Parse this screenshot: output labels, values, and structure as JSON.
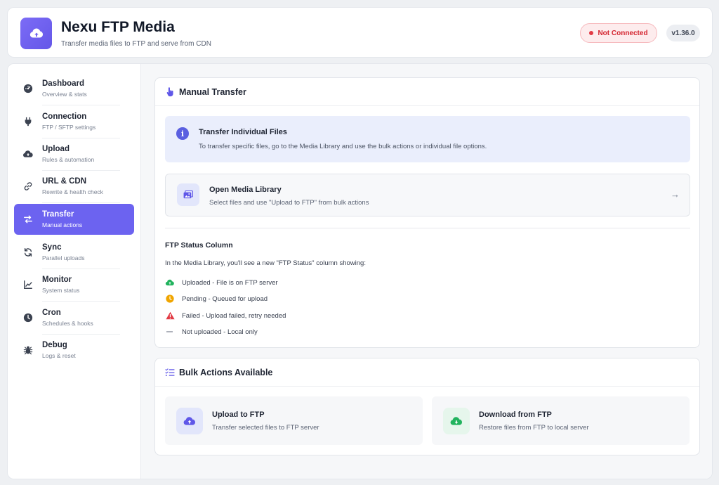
{
  "header": {
    "title": "Nexu FTP Media",
    "subtitle": "Transfer media files to FTP and serve from CDN",
    "status": "Not Connected",
    "version": "v1.36.0",
    "logo_icon": "cloud-upload-icon"
  },
  "sidebar": {
    "items": [
      {
        "label": "Dashboard",
        "desc": "Overview & stats",
        "icon": "gauge-icon"
      },
      {
        "label": "Connection",
        "desc": "FTP / SFTP settings",
        "icon": "plug-icon"
      },
      {
        "label": "Upload",
        "desc": "Rules & automation",
        "icon": "cloud-upload-icon"
      },
      {
        "label": "URL & CDN",
        "desc": "Rewrite & health check",
        "icon": "link-icon"
      },
      {
        "label": "Transfer",
        "desc": "Manual actions",
        "icon": "arrows-exchange-icon",
        "active": true
      },
      {
        "label": "Sync",
        "desc": "Parallel uploads",
        "icon": "sync-icon"
      },
      {
        "label": "Monitor",
        "desc": "System status",
        "icon": "chart-line-icon"
      },
      {
        "label": "Cron",
        "desc": "Schedules & hooks",
        "icon": "clock-icon"
      },
      {
        "label": "Debug",
        "desc": "Logs & reset",
        "icon": "bug-icon"
      }
    ]
  },
  "manual_transfer": {
    "title": "Manual Transfer",
    "info_title": "Transfer Individual Files",
    "info_text": "To transfer specific files, go to the Media Library and use the bulk actions or individual file options.",
    "link_title": "Open Media Library",
    "link_text": "Select files and use \"Upload to FTP\" from bulk actions",
    "status_title": "FTP Status Column",
    "status_intro": "In the Media Library, you'll see a new \"FTP Status\" column showing:",
    "statuses": [
      {
        "text": "Uploaded - File is on FTP server",
        "icon": "cloud-check-icon",
        "color": "#22b35e"
      },
      {
        "text": "Pending - Queued for upload",
        "icon": "clock-icon",
        "color": "#f0a500"
      },
      {
        "text": "Failed - Upload failed, retry needed",
        "icon": "warning-icon",
        "color": "#e23a44"
      },
      {
        "text": "Not uploaded - Local only",
        "icon": "dash-icon",
        "color": "#8a909c"
      }
    ]
  },
  "bulk_actions": {
    "title": "Bulk Actions Available",
    "upload_title": "Upload to FTP",
    "upload_text": "Transfer selected files to FTP server",
    "download_title": "Download from FTP",
    "download_text": "Restore files from FTP to local server"
  },
  "colors": {
    "accent": "#6c63f0",
    "danger": "#d4242f",
    "success": "#22b35e"
  }
}
